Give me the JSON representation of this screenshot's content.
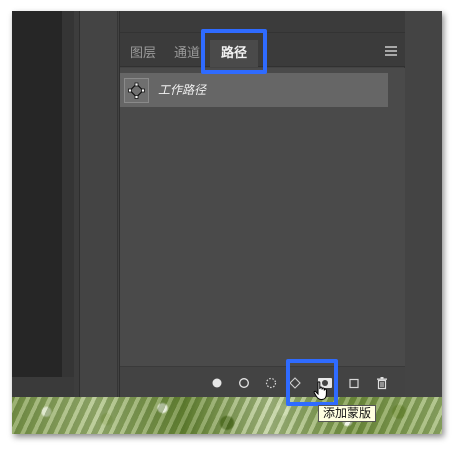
{
  "panel": {
    "tabs": [
      {
        "label": "图层",
        "active": false
      },
      {
        "label": "通道",
        "active": false
      },
      {
        "label": "路径",
        "active": true
      }
    ],
    "menu_icon": "panel-menu-icon"
  },
  "paths": [
    {
      "name": "工作路径",
      "icon": "path-thumbnail-icon",
      "selected": true
    }
  ],
  "footer": {
    "buttons": [
      {
        "name": "fill-path-button",
        "icon": "filled-circle-icon"
      },
      {
        "name": "stroke-path-button",
        "icon": "circle-outline-icon"
      },
      {
        "name": "load-selection-button",
        "icon": "dotted-circle-icon"
      },
      {
        "name": "make-work-path-button",
        "icon": "diamond-outline-icon"
      },
      {
        "name": "add-mask-button",
        "icon": "mask-icon"
      },
      {
        "name": "new-path-button",
        "icon": "new-square-icon"
      },
      {
        "name": "delete-path-button",
        "icon": "trash-icon"
      }
    ]
  },
  "tooltip": {
    "text": "添加蒙版"
  },
  "colors": {
    "highlight": "#2f6bff",
    "panel_bg": "#4a4a4a",
    "selected_row": "#666666"
  }
}
